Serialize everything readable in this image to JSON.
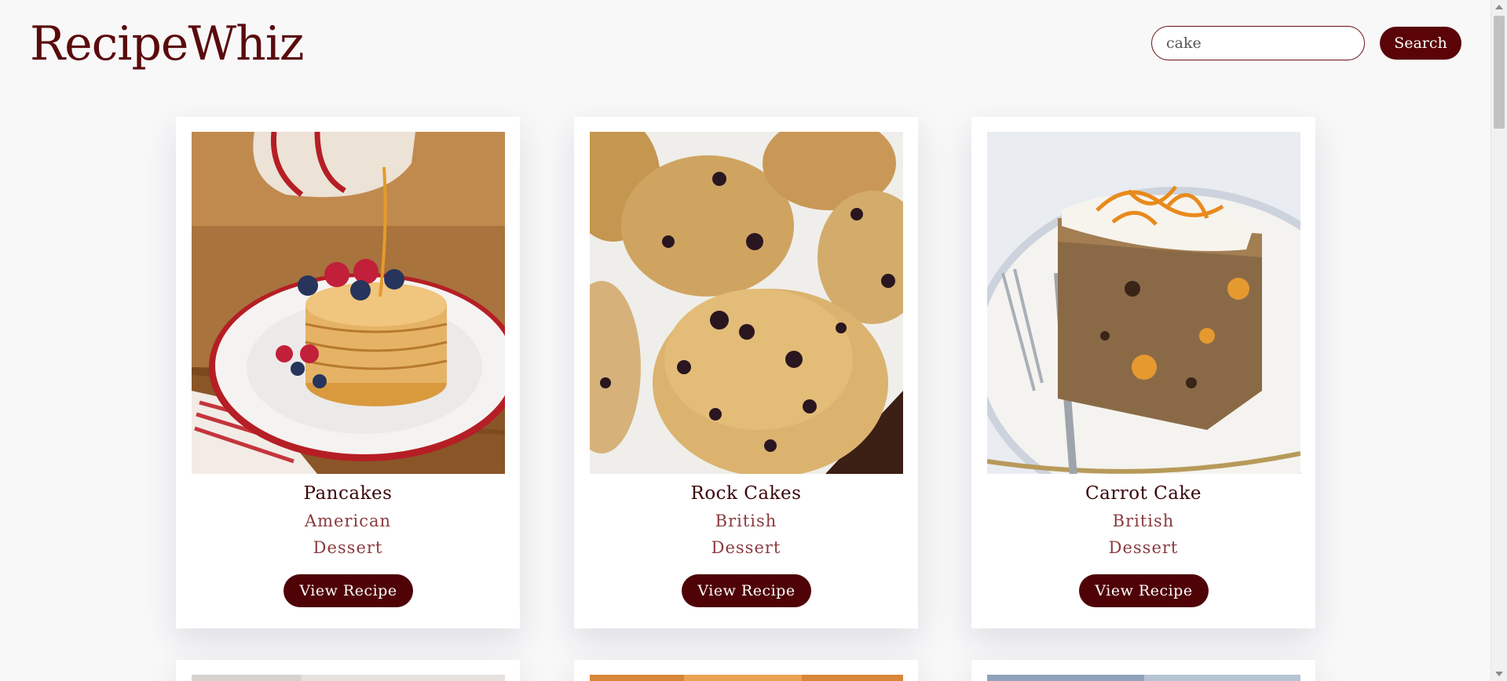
{
  "header": {
    "logo": "RecipeWhiz",
    "search_value": "cake",
    "search_button": "Search"
  },
  "recipes": [
    {
      "title": "Pancakes",
      "cuisine": "American",
      "category": "Dessert",
      "button": "View Recipe",
      "image": "pancakes-photo"
    },
    {
      "title": "Rock Cakes",
      "cuisine": "British",
      "category": "Dessert",
      "button": "View Recipe",
      "image": "rock-cakes-photo"
    },
    {
      "title": "Carrot Cake",
      "cuisine": "British",
      "category": "Dessert",
      "button": "View Recipe",
      "image": "carrot-cake-photo"
    }
  ],
  "colors": {
    "brand": "#5a0408",
    "text_secondary": "#8a3a3e",
    "background": "#f8f8f9"
  }
}
